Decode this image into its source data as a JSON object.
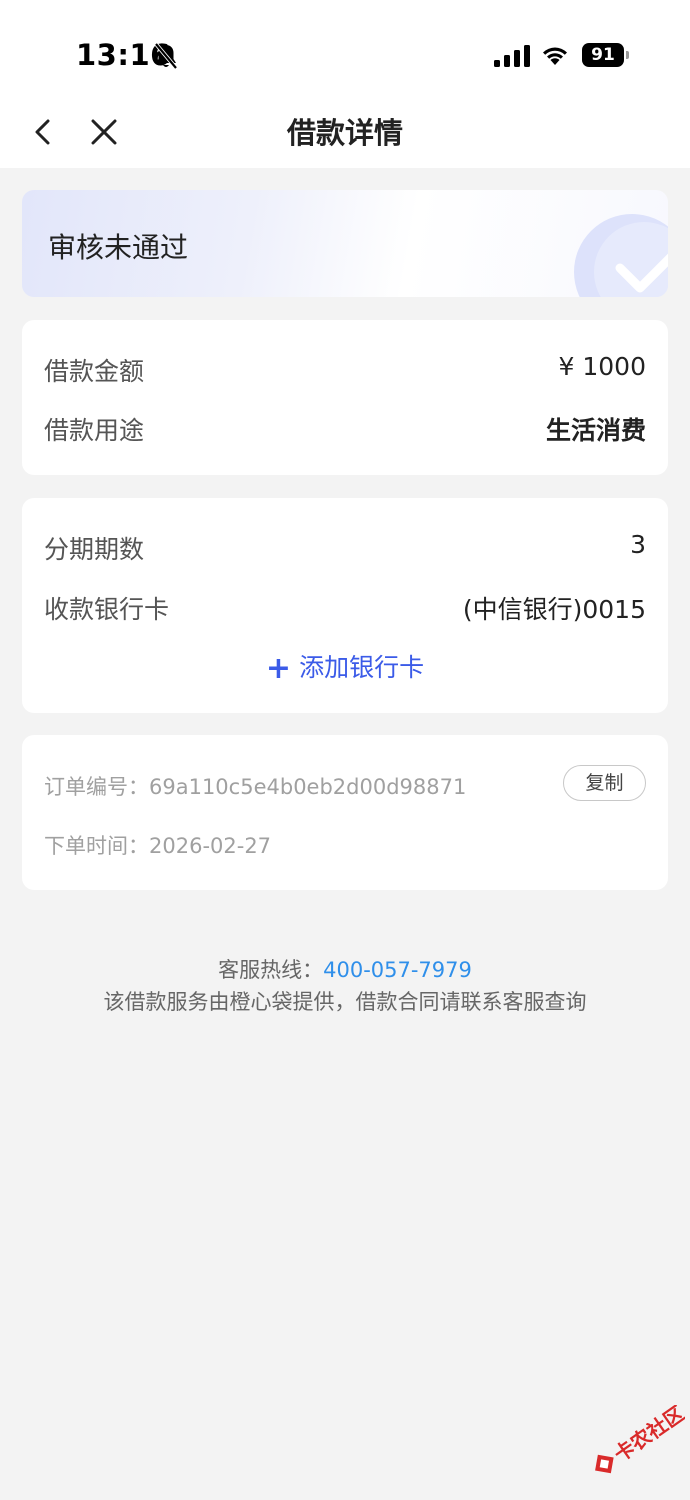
{
  "status_bar": {
    "time": "13:16",
    "battery": "91",
    "icons": [
      "bell-slash-icon",
      "signal-icon",
      "wifi-icon",
      "battery-icon"
    ]
  },
  "nav": {
    "title": "借款详情",
    "back_icon": "chevron-left-icon",
    "close_icon": "close-icon"
  },
  "status_card": {
    "status_text": "审核未通过",
    "decor_icon": "check-circle-icon"
  },
  "loan": {
    "amount_label": "借款金额",
    "amount_value": "¥ 1000",
    "purpose_label": "借款用途",
    "purpose_value": "生活消费"
  },
  "installment": {
    "terms_label": "分期期数",
    "terms_value": "3",
    "bank_label": "收款银行卡",
    "bank_value": "(中信银行)0015",
    "add_card_label": "添加银行卡"
  },
  "order": {
    "number_label": "订单编号：",
    "number_value": "69a110c5e4b0eb2d00d98871",
    "copy_label": "复制",
    "time_label": "下单时间：",
    "time_value": "2026-02-27"
  },
  "footer": {
    "hotline_label": "客服热线：",
    "hotline_number": "400-057-7979",
    "notice": "该借款服务由橙心袋提供，借款合同请联系客服查询"
  },
  "watermark": {
    "text": "卡农社区"
  },
  "colors": {
    "accent_blue": "#3b5be8",
    "link_blue": "#2f8fea",
    "background": "#f3f3f3"
  }
}
